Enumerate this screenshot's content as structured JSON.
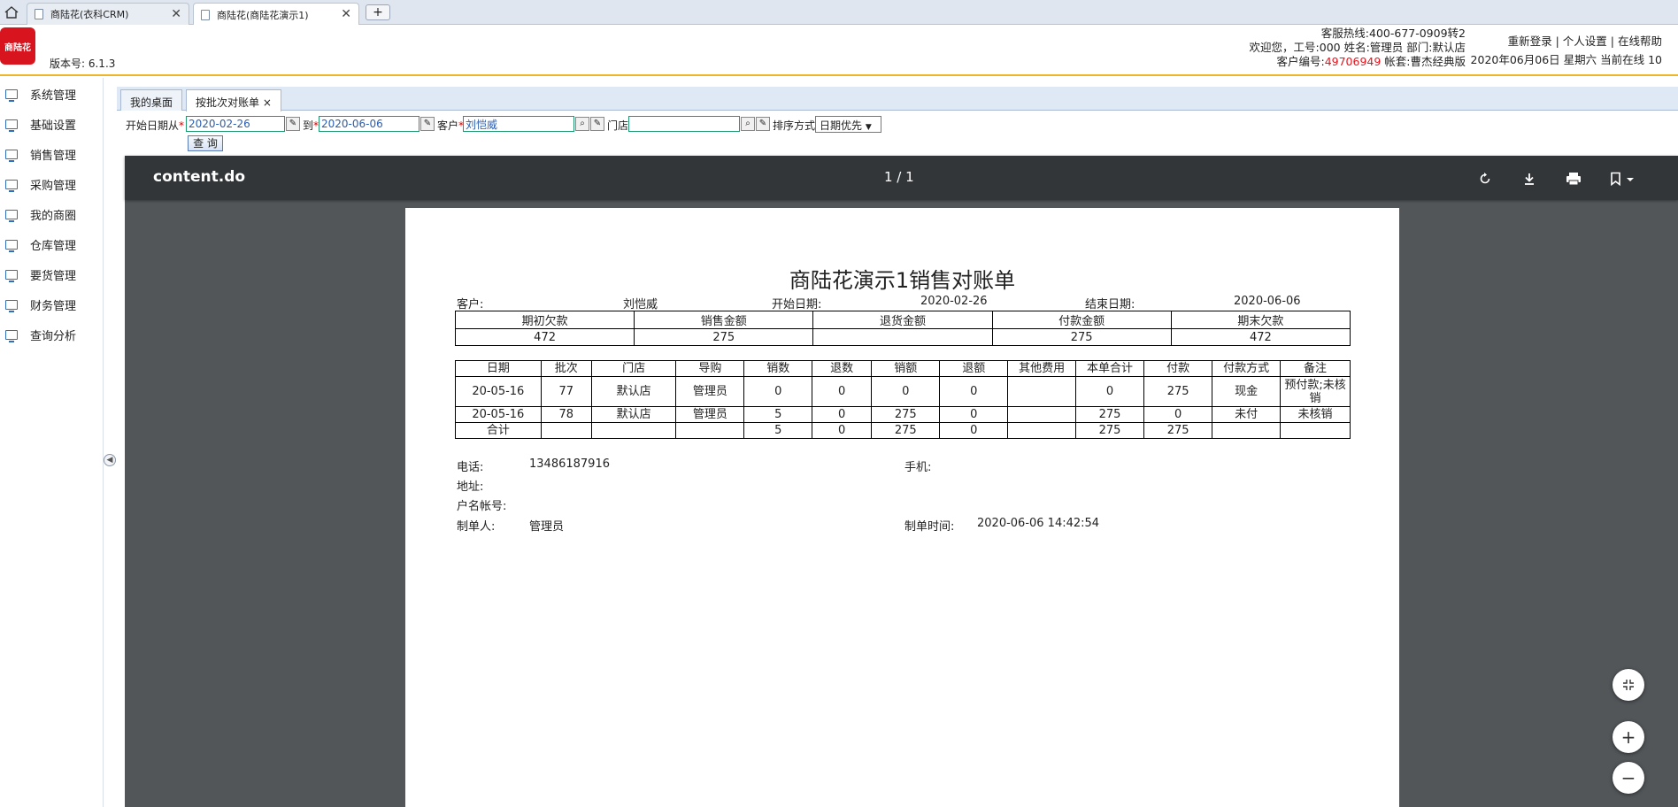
{
  "browser": {
    "tabs": [
      {
        "title": "商陆花(衣科CRM)"
      },
      {
        "title": "商陆花(商陆花演示1)"
      }
    ],
    "new_tab": "+"
  },
  "header": {
    "logo_text": "商陆花",
    "version": "版本号: 6.1.3",
    "hotline": "客服热线:400-677-0909转2",
    "welcome": "欢迎您，工号:000 姓名:管理员 部门:默认店",
    "customer_no_label": "客户编号:",
    "customer_no": "49706949",
    "account": " 帐套:曹杰经典版",
    "links": [
      "重新登录",
      "个人设置",
      "在线帮助"
    ],
    "datetime": "2020年06月06日 星期六 当前在线 10"
  },
  "sidebar": {
    "items": [
      "系统管理",
      "基础设置",
      "销售管理",
      "采购管理",
      "我的商圈",
      "仓库管理",
      "要货管理",
      "财务管理",
      "查询分析"
    ]
  },
  "content_tabs": [
    {
      "label": "我的桌面"
    },
    {
      "label": "按批次对账单",
      "close": "×"
    }
  ],
  "filter": {
    "start_label": "开始日期从",
    "start_value": "2020-02-26",
    "to_label": "到",
    "end_value": "2020-06-06",
    "customer_label": "客户",
    "customer_value": "刘恺威",
    "store_label": "门店",
    "store_value": "",
    "sort_label": "排序方式",
    "sort_value": "日期优先",
    "query_button": "查 询",
    "required_mark": "*"
  },
  "viewer": {
    "filename": "content.do",
    "page_indicator": "1 / 1",
    "icons": [
      "rotate-icon",
      "download-icon",
      "print-icon",
      "bookmark-icon"
    ]
  },
  "document": {
    "title": "商陆花演示1销售对账单",
    "meta": {
      "customer_label": "客户:",
      "customer": "刘恺威",
      "start_label": "开始日期:",
      "start": "2020-02-26",
      "end_label": "结束日期:",
      "end": "2020-06-06"
    },
    "summary": {
      "headers": [
        "期初欠款",
        "销售金额",
        "退货金额",
        "付款金额",
        "期末欠款"
      ],
      "values": [
        "472",
        "275",
        "",
        "275",
        "472"
      ]
    },
    "detail": {
      "headers": [
        "日期",
        "批次",
        "门店",
        "导购",
        "销数",
        "退数",
        "销额",
        "退额",
        "其他费用",
        "本单合计",
        "付款",
        "付款方式",
        "备注"
      ],
      "rows": [
        [
          "20-05-16",
          "77",
          "默认店",
          "管理员",
          "0",
          "0",
          "0",
          "0",
          "",
          "0",
          "275",
          "现金",
          "预付款;未核销"
        ],
        [
          "20-05-16",
          "78",
          "默认店",
          "管理员",
          "5",
          "0",
          "275",
          "0",
          "",
          "275",
          "0",
          "未付",
          "未核销"
        ],
        [
          "合计",
          "",
          "",
          "",
          "5",
          "0",
          "275",
          "0",
          "",
          "275",
          "275",
          "",
          ""
        ]
      ]
    },
    "footer": {
      "phone_label": "电话:",
      "phone": "13486187916",
      "mobile_label": "手机:",
      "address_label": "地址:",
      "account_label": "户名帐号:",
      "maker_label": "制单人:",
      "maker": "管理员",
      "time_label": "制单时间:",
      "time": "2020-06-06 14:42:54"
    }
  }
}
